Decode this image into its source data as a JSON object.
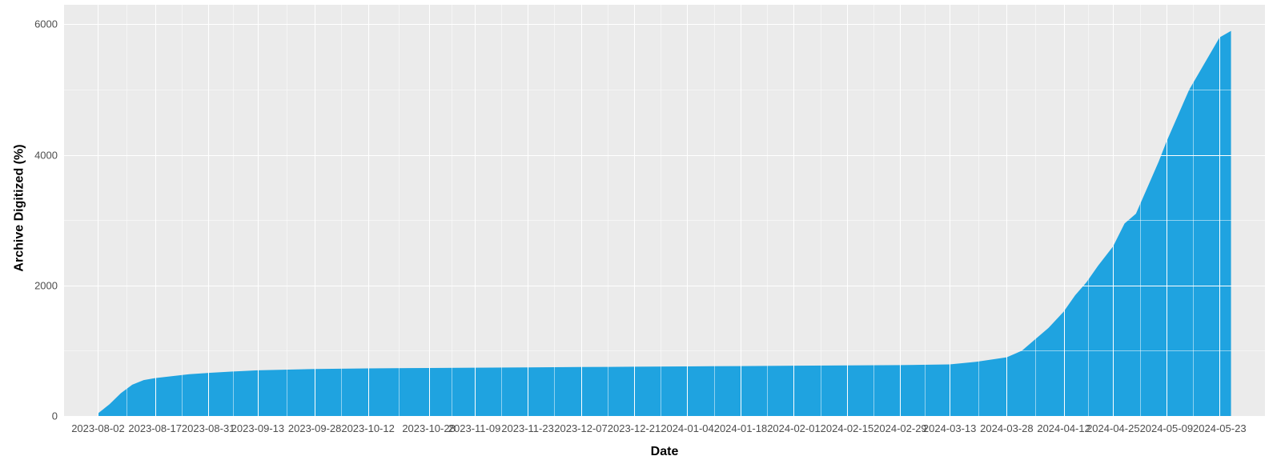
{
  "chart_data": {
    "type": "area",
    "title": "",
    "xlabel": "Date",
    "ylabel": "Archive Digitized (%)",
    "ylim": [
      0,
      6300
    ],
    "y_ticks": [
      0,
      2000,
      4000,
      6000
    ],
    "y_minor_ticks": [
      1000,
      3000,
      5000
    ],
    "x_ticks": [
      "2023-08-02",
      "2023-08-17",
      "2023-08-31",
      "2023-09-13",
      "2023-09-28",
      "2023-10-12",
      "2023-10-28",
      "2023-11-09",
      "2023-11-23",
      "2023-12-07",
      "2023-12-21",
      "2024-01-04",
      "2024-01-18",
      "2024-02-01",
      "2024-02-15",
      "2024-02-29",
      "2024-03-13",
      "2024-03-28",
      "2024-04-12",
      "2024-04-25",
      "2024-05-09",
      "2024-05-23"
    ],
    "series": [
      {
        "name": "Archive Digitized (%)",
        "color": "#1fa3e0",
        "x": [
          "2023-08-02",
          "2023-08-05",
          "2023-08-08",
          "2023-08-11",
          "2023-08-14",
          "2023-08-17",
          "2023-08-20",
          "2023-08-23",
          "2023-08-26",
          "2023-08-31",
          "2023-09-06",
          "2023-09-13",
          "2023-09-20",
          "2023-09-28",
          "2023-10-12",
          "2023-10-28",
          "2023-11-09",
          "2023-11-23",
          "2023-12-07",
          "2023-12-21",
          "2024-01-04",
          "2024-01-18",
          "2024-02-01",
          "2024-02-15",
          "2024-02-29",
          "2024-03-13",
          "2024-03-20",
          "2024-03-28",
          "2024-04-01",
          "2024-04-04",
          "2024-04-08",
          "2024-04-12",
          "2024-04-15",
          "2024-04-18",
          "2024-04-21",
          "2024-04-25",
          "2024-04-28",
          "2024-05-01",
          "2024-05-04",
          "2024-05-07",
          "2024-05-09",
          "2024-05-12",
          "2024-05-15",
          "2024-05-18",
          "2024-05-21",
          "2024-05-23",
          "2024-05-26"
        ],
        "y": [
          40,
          180,
          350,
          480,
          550,
          580,
          600,
          620,
          640,
          660,
          680,
          700,
          710,
          720,
          730,
          735,
          740,
          745,
          750,
          755,
          760,
          765,
          770,
          775,
          780,
          790,
          830,
          900,
          1000,
          1150,
          1350,
          1600,
          1850,
          2050,
          2300,
          2600,
          2950,
          3100,
          3500,
          3900,
          4200,
          4600,
          5000,
          5300,
          5600,
          5800,
          5900
        ]
      }
    ]
  }
}
